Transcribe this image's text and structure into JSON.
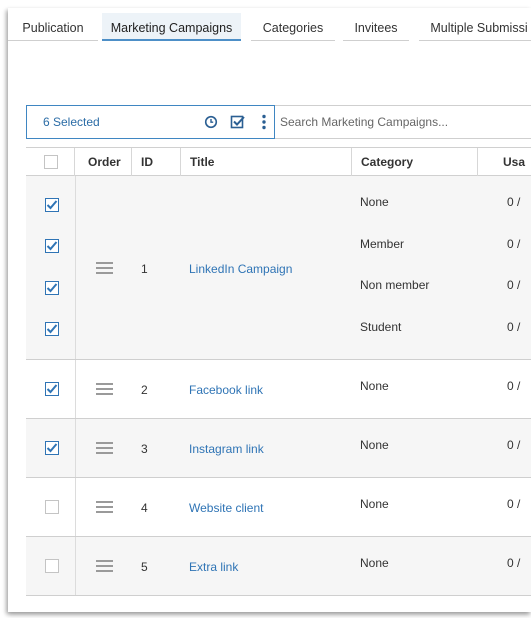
{
  "tabs": [
    {
      "label": "Publication",
      "active": false
    },
    {
      "label": "Marketing Campaigns",
      "active": true
    },
    {
      "label": "Categories",
      "active": false
    },
    {
      "label": "Invitees",
      "active": false
    },
    {
      "label": "Multiple Submissi",
      "active": false
    }
  ],
  "toolbar": {
    "selected_label": "6 Selected",
    "icons": [
      "clock-icon",
      "check-square-icon",
      "more-vertical-icon"
    ],
    "search_placeholder": "Search Marketing Campaigns..."
  },
  "table": {
    "headers": [
      "Order",
      "ID",
      "Title",
      "Category",
      "Usa"
    ],
    "header_checkbox_checked": false,
    "rows": [
      {
        "id": "1",
        "title": "LinkedIn Campaign",
        "categories": [
          {
            "name": "None",
            "usage": "0 /",
            "checked": true
          },
          {
            "name": "Member",
            "usage": "0 /",
            "checked": true
          },
          {
            "name": "Non member",
            "usage": "0 /",
            "checked": true
          },
          {
            "name": "Student",
            "usage": "0 /",
            "checked": true
          }
        ]
      },
      {
        "id": "2",
        "title": "Facebook link",
        "categories": [
          {
            "name": "None",
            "usage": "0 /",
            "checked": true
          }
        ]
      },
      {
        "id": "3",
        "title": "Instagram link",
        "categories": [
          {
            "name": "None",
            "usage": "0 /",
            "checked": true
          }
        ]
      },
      {
        "id": "4",
        "title": "Website client",
        "categories": [
          {
            "name": "None",
            "usage": "0 /",
            "checked": false
          }
        ]
      },
      {
        "id": "5",
        "title": "Extra link",
        "categories": [
          {
            "name": "None",
            "usage": "0 /",
            "checked": false
          }
        ]
      }
    ]
  },
  "colors": {
    "accent": "#2f74b5",
    "active_tab_bg": "#edf3f8",
    "row_alt_bg": "#f6f6f6"
  }
}
